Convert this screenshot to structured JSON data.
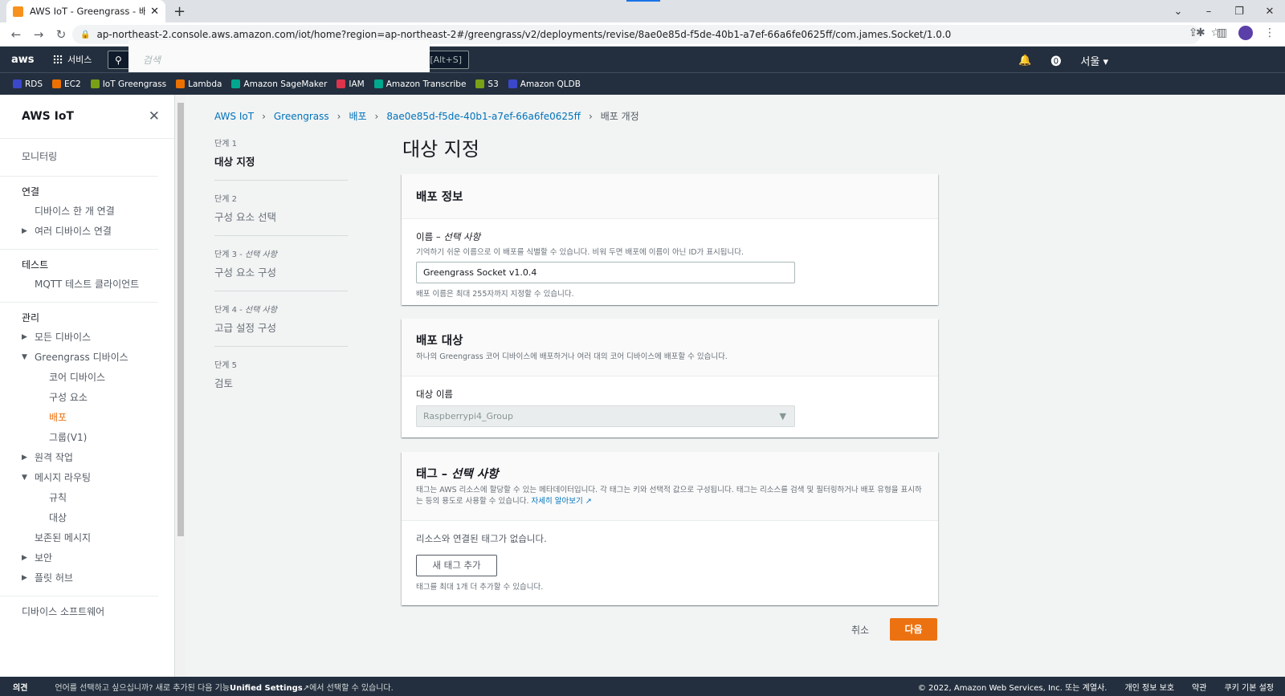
{
  "browser": {
    "tab_title": "AWS IoT - Greengrass - 배포 - |",
    "url": "ap-northeast-2.console.aws.amazon.com/iot/home?region=ap-northeast-2#/greengrass/v2/deployments/revise/8ae0e85d-f5de-40b1-a7ef-66a6fe0625ff/com.james.Socket/1.0.0"
  },
  "awsnav": {
    "logo": "aws",
    "services": "서비스",
    "search_placeholder": "검색",
    "search_shortcut": "[Alt+S]",
    "region": "서울 ▾"
  },
  "favorites": [
    {
      "label": "RDS",
      "color": "#3b48cc"
    },
    {
      "label": "EC2",
      "color": "#ed7100"
    },
    {
      "label": "IoT Greengrass",
      "color": "#7aa116"
    },
    {
      "label": "Lambda",
      "color": "#ed7100"
    },
    {
      "label": "Amazon SageMaker",
      "color": "#01a88d"
    },
    {
      "label": "IAM",
      "color": "#dd344c"
    },
    {
      "label": "Amazon Transcribe",
      "color": "#01a88d"
    },
    {
      "label": "S3",
      "color": "#7aa116"
    },
    {
      "label": "Amazon QLDB",
      "color": "#3b48cc"
    }
  ],
  "sidebar": {
    "title": "AWS IoT",
    "monitoring": "모니터링",
    "connect": {
      "heading": "연결",
      "item1": "디바이스 한 개 연결",
      "item2": "여러 디바이스 연결"
    },
    "test": {
      "heading": "테스트",
      "item1": "MQTT 테스트 클라이언트"
    },
    "manage": {
      "heading": "관리",
      "all_devices": "모든 디바이스",
      "greengrass_devices": "Greengrass 디바이스",
      "core_devices": "코어 디바이스",
      "components": "구성 요소",
      "deployments": "배포",
      "groups_v1": "그룹(V1)",
      "remote_actions": "원격 작업",
      "message_routing": "메시지 라우팅",
      "rules": "규칙",
      "destinations": "대상",
      "retained_messages": "보존된 메시지",
      "security": "보안",
      "fleet_hub": "플릿 허브"
    },
    "device_software": "디바이스 소프트웨어"
  },
  "breadcrumb": {
    "b1": "AWS IoT",
    "b2": "Greengrass",
    "b3": "배포",
    "b4": "8ae0e85d-f5de-40b1-a7ef-66a6fe0625ff",
    "current": "배포 개정"
  },
  "steps": {
    "s1": {
      "num": "단계 1",
      "label": "대상 지정"
    },
    "s2": {
      "num": "단계 2",
      "label": "구성 요소 선택"
    },
    "s3": {
      "num": "단계 3 -",
      "opt": "선택 사항",
      "label": "구성 요소 구성"
    },
    "s4": {
      "num": "단계 4 -",
      "opt": "선택 사항",
      "label": "고급 설정 구성"
    },
    "s5": {
      "num": "단계 5",
      "label": "검토"
    }
  },
  "page_title": "대상 지정",
  "deploy_info": {
    "title": "배포 정보",
    "name_label": "이름 –",
    "name_optional": "선택 사항",
    "name_desc": "기억하기 쉬운 이름으로 이 배포를 식별할 수 있습니다. 비워 두면 배포에 이름이 아닌 ID가 표시됩니다.",
    "name_value": "Greengrass Socket v1.0.4",
    "name_hint": "배포 이름은 최대 255자까지 지정할 수 있습니다."
  },
  "deploy_target": {
    "title": "배포 대상",
    "desc": "하나의 Greengrass 코어 디바이스에 배포하거나 여러 대의 코어 디바이스에 배포할 수 있습니다.",
    "target_label": "대상 이름",
    "target_value": "Raspberrypi4_Group"
  },
  "tags": {
    "title": "태그 –",
    "title_optional": "선택 사항",
    "desc": "태그는 AWS 리소스에 할당할 수 있는 메타데이터입니다. 각 태그는 키와 선택적 값으로 구성됩니다. 태그는 리소스를 검색 및 필터링하거나 배포 유형을 표시하는 등의 용도로 사용할 수 있습니다.",
    "learn_more": "자세히 알아보기",
    "no_tags": "리소스와 연결된 태그가 없습니다.",
    "add_button": "새 태그 추가",
    "hint": "태그를 최대 1개 더 추가할 수 있습니다."
  },
  "actions": {
    "cancel": "취소",
    "next": "다음"
  },
  "footer": {
    "feedback": "의견",
    "msg_pre": "언어를 선택하고 싶으십니까? 새로 추가된 다음 기능",
    "msg_bold": "Unified Settings",
    "msg_post": "에서 선택할 수 있습니다.",
    "copyright": "© 2022, Amazon Web Services, Inc. 또는 계열사.",
    "privacy": "개인 정보 보호",
    "terms": "약관",
    "cookies": "쿠키 기본 설정"
  }
}
